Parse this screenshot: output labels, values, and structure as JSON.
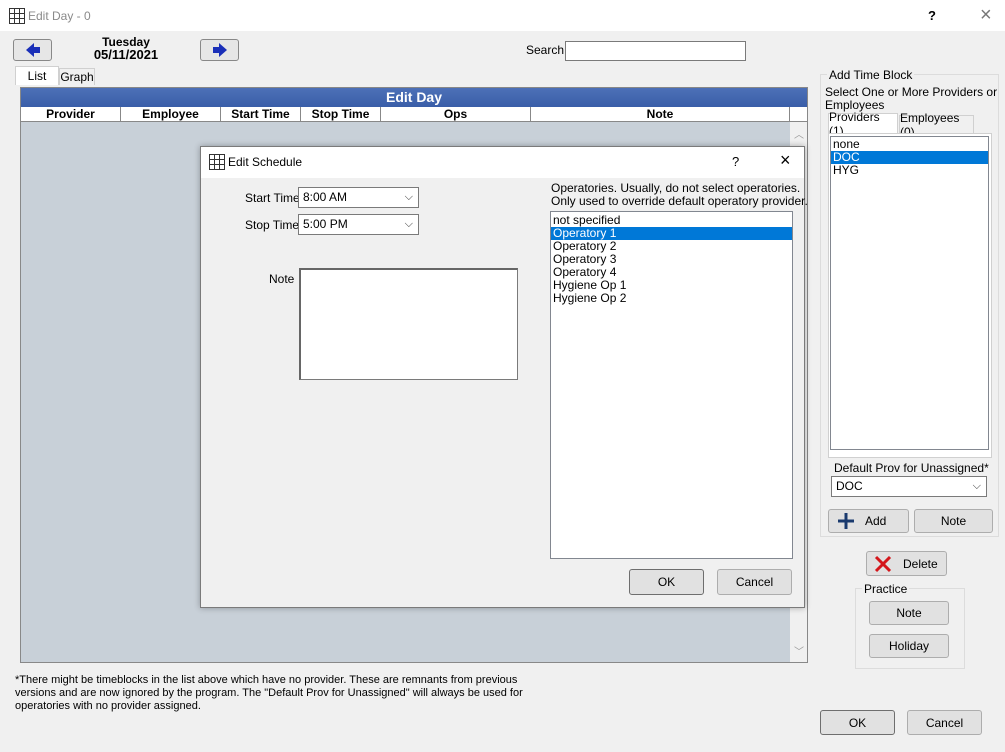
{
  "window": {
    "title": "Edit Day - 0",
    "help": "?",
    "close": "×"
  },
  "nav": {
    "day_name": "Tuesday",
    "date": "05/11/2021"
  },
  "search": {
    "label": "Search",
    "value": ""
  },
  "tabs": [
    "List",
    "Graph"
  ],
  "grid": {
    "title": "Edit Day",
    "columns": [
      "Provider",
      "Employee",
      "Start Time",
      "Stop Time",
      "Ops",
      "Note"
    ]
  },
  "edit_schedule": {
    "title": "Edit Schedule",
    "help": "?",
    "close": "×",
    "start_label": "Start Time",
    "start_value": "8:00 AM",
    "stop_label": "Stop Time",
    "stop_value": "5:00 PM",
    "note_label": "Note",
    "note_value": "",
    "ops_hint_1": "Operatories. Usually, do not select operatories.",
    "ops_hint_2": "Only used to override default operatory provider.",
    "operatories": [
      "not specified",
      "Operatory 1",
      "Operatory 2",
      "Operatory 3",
      "Operatory 4",
      "Hygiene Op 1",
      "Hygiene Op 2"
    ],
    "selected_operatory": "Operatory 1",
    "ok": "OK",
    "cancel": "Cancel"
  },
  "add_time_block": {
    "group_title": "Add Time Block",
    "instruction_1": "Select One or More Providers or",
    "instruction_2": "Employees",
    "tab_providers": "Providers (1)",
    "tab_employees": "Employees (0)",
    "providers": [
      "none",
      "DOC",
      "HYG"
    ],
    "selected_provider": "DOC",
    "default_prov_label": "Default Prov for Unassigned*",
    "default_prov_value": "DOC",
    "add": "Add",
    "note": "Note"
  },
  "delete": "Delete",
  "practice": {
    "group_title": "Practice",
    "note": "Note",
    "holiday": "Holiday"
  },
  "footnote_1": "*There might be timeblocks in the list above which have no provider.  These are remnants from previous",
  "footnote_2": "versions and are now ignored by the program.  The \"Default Prov for Unassigned\" will always be used for",
  "footnote_3": "operatories with no provider assigned.",
  "ok": "OK",
  "cancel": "Cancel",
  "colors": {
    "accent": "#0078d7",
    "grid_header": "#3a5ea8",
    "grid_bg": "#c8d0d8",
    "nav_arrow": "#1a2fb8",
    "delete_x": "#d4161b"
  }
}
